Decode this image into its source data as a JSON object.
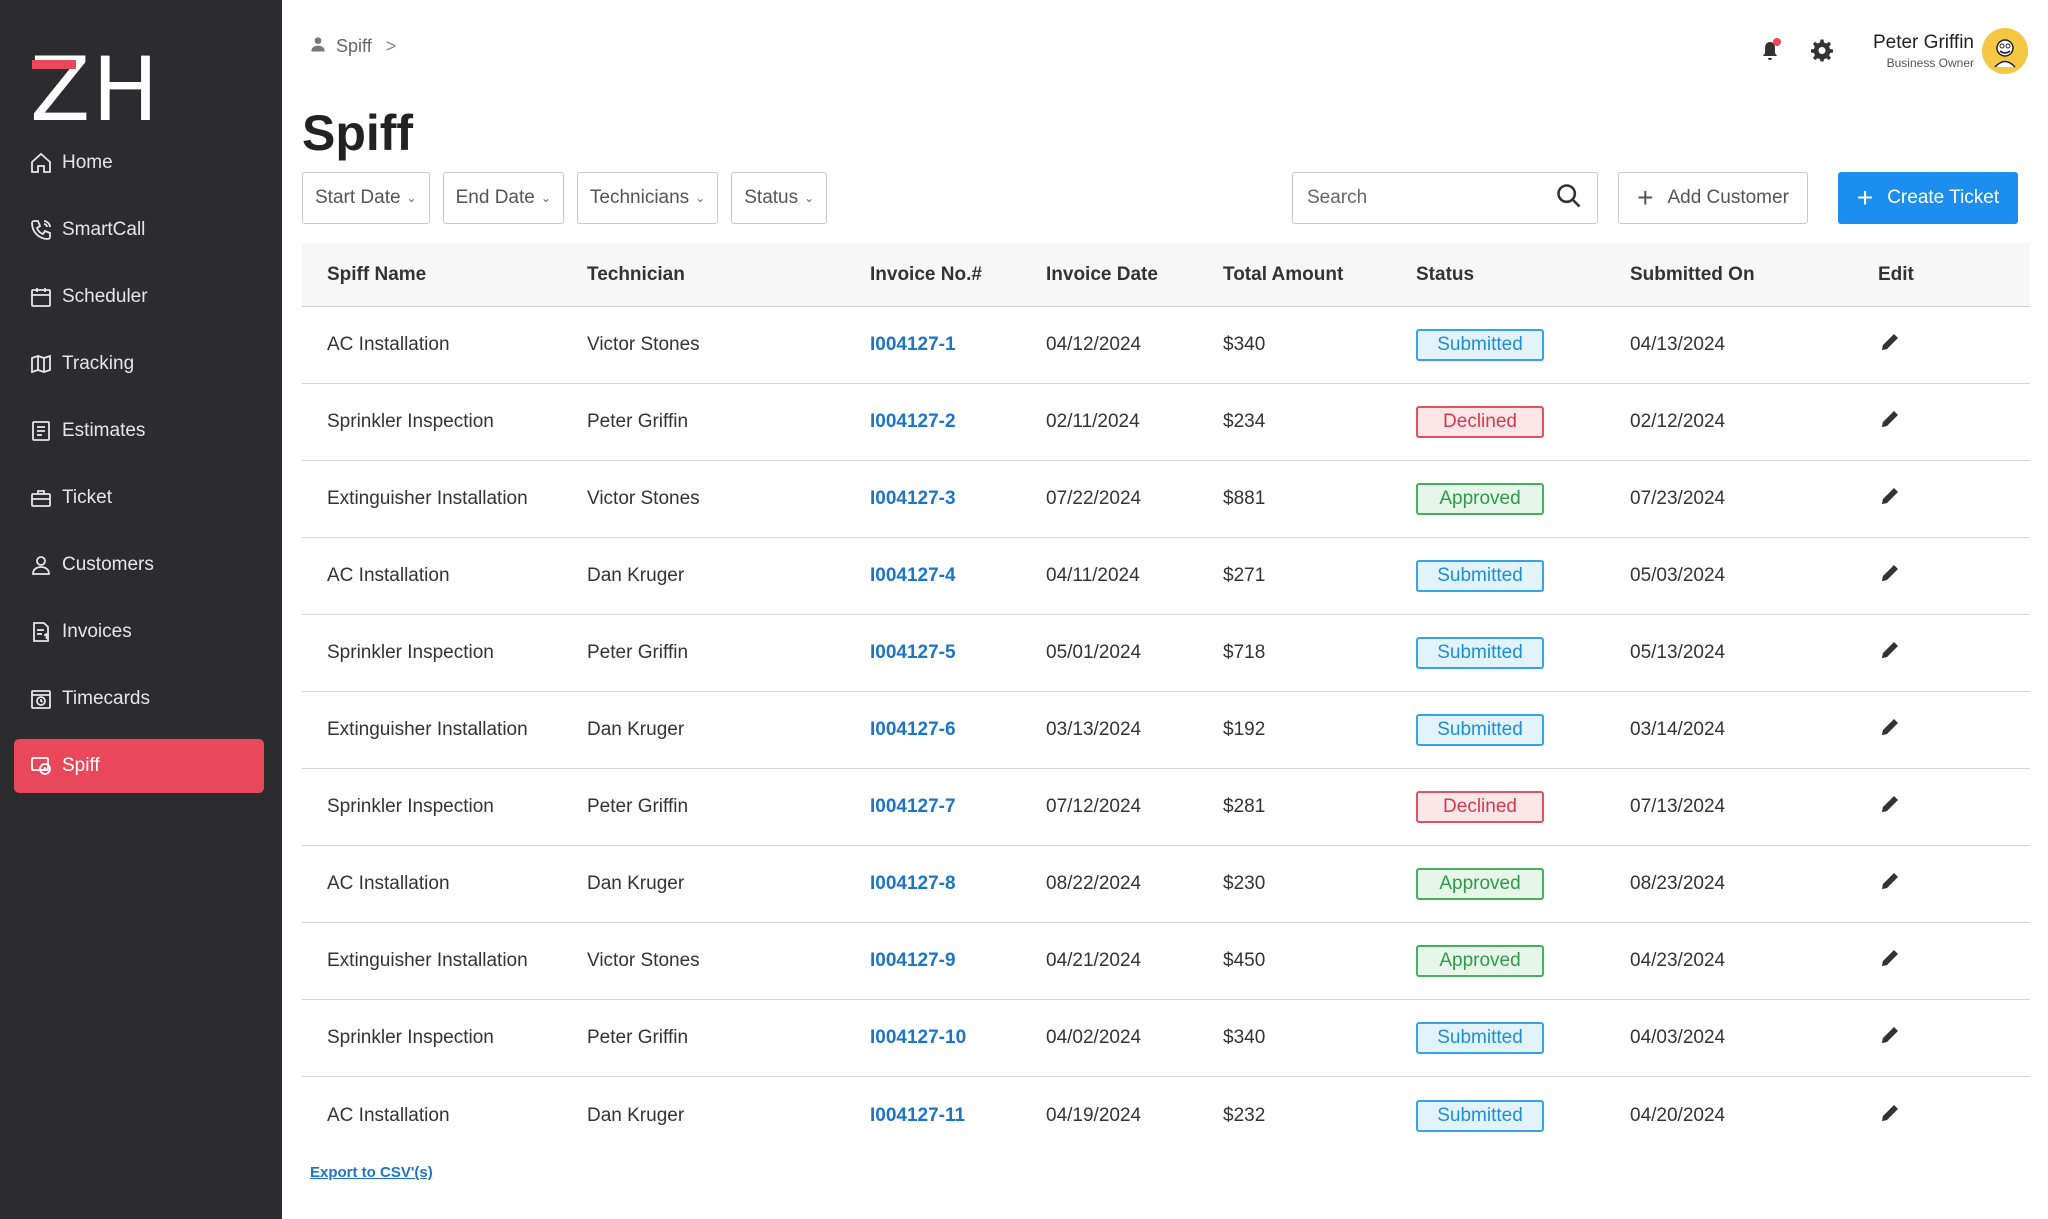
{
  "brand": {
    "logo_text": "ZH",
    "accent": "#e8485a"
  },
  "sidebar": {
    "items": [
      {
        "label": "Home",
        "icon": "home-icon"
      },
      {
        "label": "SmartCall",
        "icon": "phone-icon"
      },
      {
        "label": "Scheduler",
        "icon": "calendar-icon"
      },
      {
        "label": "Tracking",
        "icon": "map-icon"
      },
      {
        "label": "Estimates",
        "icon": "document-icon"
      },
      {
        "label": "Ticket",
        "icon": "toolbox-icon"
      },
      {
        "label": "Customers",
        "icon": "user-icon"
      },
      {
        "label": "Invoices",
        "icon": "invoice-icon"
      },
      {
        "label": "Timecards",
        "icon": "timecard-icon"
      },
      {
        "label": "Spiff",
        "icon": "spiff-icon",
        "active": true
      }
    ]
  },
  "breadcrumb": {
    "label": "Spiff",
    "separator": ">"
  },
  "user": {
    "name": "Peter Griffin",
    "role": "Business Owner"
  },
  "page": {
    "title": "Spiff"
  },
  "filters": [
    {
      "label": "Start Date"
    },
    {
      "label": "End Date"
    },
    {
      "label": "Technicians"
    },
    {
      "label": "Status"
    }
  ],
  "search": {
    "placeholder": "Search"
  },
  "actions": {
    "add_customer": "Add Customer",
    "create_ticket": "Create Ticket"
  },
  "table": {
    "columns": [
      "Spiff Name",
      "Technician",
      "Invoice No.#",
      "Invoice Date",
      "Total Amount",
      "Status",
      "Submitted On",
      "Edit"
    ],
    "rows": [
      {
        "spiff": "AC Installation",
        "tech": "Victor Stones",
        "invoice": "I004127-1",
        "date": "04/12/2024",
        "amount": "$340",
        "status": "Submitted",
        "submitted": "04/13/2024"
      },
      {
        "spiff": "Sprinkler Inspection",
        "tech": "Peter Griffin",
        "invoice": "I004127-2",
        "date": "02/11/2024",
        "amount": "$234",
        "status": "Declined",
        "submitted": "02/12/2024"
      },
      {
        "spiff": "Extinguisher Installation",
        "tech": "Victor Stones",
        "invoice": "I004127-3",
        "date": "07/22/2024",
        "amount": "$881",
        "status": "Approved",
        "submitted": "07/23/2024"
      },
      {
        "spiff": "AC Installation",
        "tech": "Dan Kruger",
        "invoice": "I004127-4",
        "date": "04/11/2024",
        "amount": "$271",
        "status": "Submitted",
        "submitted": "05/03/2024"
      },
      {
        "spiff": "Sprinkler Inspection",
        "tech": "Peter Griffin",
        "invoice": "I004127-5",
        "date": "05/01/2024",
        "amount": "$718",
        "status": "Submitted",
        "submitted": "05/13/2024"
      },
      {
        "spiff": "Extinguisher Installation",
        "tech": "Dan Kruger",
        "invoice": "I004127-6",
        "date": "03/13/2024",
        "amount": "$192",
        "status": "Submitted",
        "submitted": "03/14/2024"
      },
      {
        "spiff": "Sprinkler Inspection",
        "tech": "Peter Griffin",
        "invoice": "I004127-7",
        "date": "07/12/2024",
        "amount": "$281",
        "status": "Declined",
        "submitted": "07/13/2024"
      },
      {
        "spiff": "AC Installation",
        "tech": "Dan Kruger",
        "invoice": "I004127-8",
        "date": "08/22/2024",
        "amount": "$230",
        "status": "Approved",
        "submitted": "08/23/2024"
      },
      {
        "spiff": "Extinguisher Installation",
        "tech": "Victor Stones",
        "invoice": "I004127-9",
        "date": "04/21/2024",
        "amount": "$450",
        "status": "Approved",
        "submitted": "04/23/2024"
      },
      {
        "spiff": "Sprinkler Inspection",
        "tech": "Peter Griffin",
        "invoice": "I004127-10",
        "date": "04/02/2024",
        "amount": "$340",
        "status": "Submitted",
        "submitted": "04/03/2024"
      },
      {
        "spiff": "AC Installation",
        "tech": "Dan Kruger",
        "invoice": "I004127-11",
        "date": "04/19/2024",
        "amount": "$232",
        "status": "Submitted",
        "submitted": "04/20/2024"
      }
    ]
  },
  "footer": {
    "export_label": "Export to CSV'(s)"
  }
}
